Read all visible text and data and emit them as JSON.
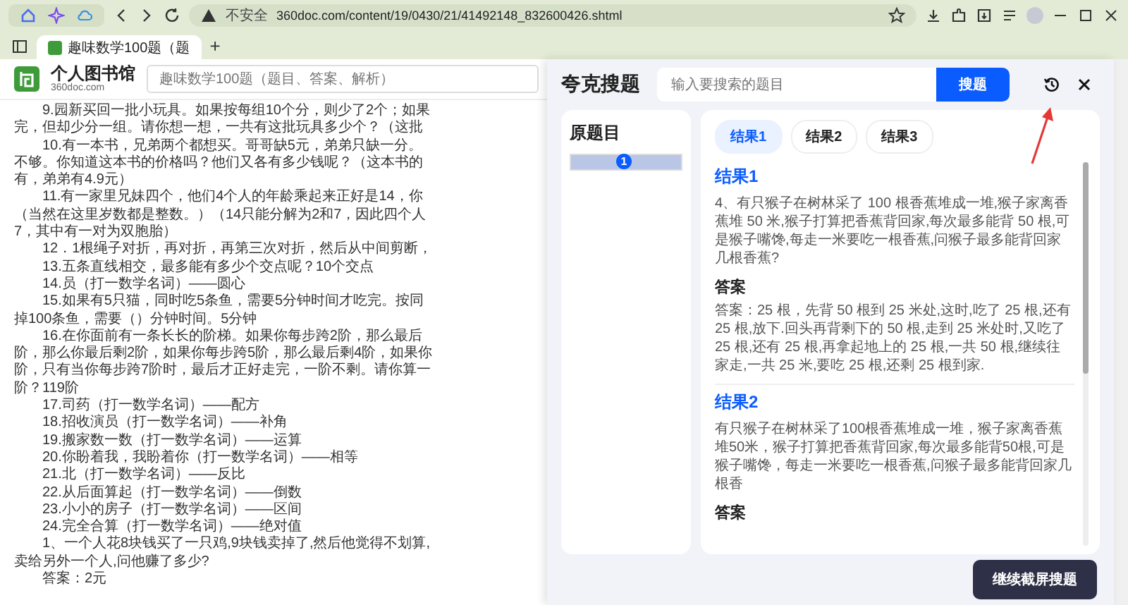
{
  "browser": {
    "security_label": "不安全",
    "url": "360doc.com/content/19/0430/21/41492148_832600426.shtml",
    "tabs": [
      {
        "title": "趣味数学100题（题",
        "selected": true
      }
    ],
    "new_tab": "+"
  },
  "site": {
    "logo_name": "个人图书馆",
    "logo_domain": "360doc.com",
    "search_placeholder": "趣味数学100题（题目、答案、解析）"
  },
  "article": {
    "lines": [
      {
        "text": "9.园新买回一批小玩具。如果按每组10个分，则少了2个；如果",
        "indent": true
      },
      {
        "text": "完，但却少分一组。请你想一想，一共有这批玩具多少个？（这批",
        "indent": false
      },
      {
        "text": "10.有一本书，兄弟两个都想买。哥哥缺5元，弟弟只缺一分。",
        "indent": true
      },
      {
        "text": "不够。你知道这本书的价格吗？他们又各有多少钱呢？（这本书的",
        "indent": false
      },
      {
        "text": "有，弟弟有4.9元）",
        "indent": false
      },
      {
        "text": "11.有一家里兄妹四个，他们4个人的年龄乘起来正好是14，你",
        "indent": true
      },
      {
        "text": "（当然在这里岁数都是整数。）（14只能分解为2和7，因此四个人",
        "indent": false
      },
      {
        "text": "7，其中有一对为双胞胎）",
        "indent": false
      },
      {
        "text": "12．1根绳子对折，再对折，再第三次对折，然后从中间剪断，",
        "indent": true
      },
      {
        "text": "13.五条直线相交，最多能有多少个交点呢？10个交点",
        "indent": true
      },
      {
        "text": "14.员（打一数学名词）——圆心",
        "indent": true
      },
      {
        "text": "15.如果有5只猫，同时吃5条鱼，需要5分钟时间才吃完。按同",
        "indent": true
      },
      {
        "text": "掉100条鱼，需要（）分钟时间。5分钟",
        "indent": false
      },
      {
        "text": "16.在你面前有一条长长的阶梯。如果你每步跨2阶，那么最后",
        "indent": true
      },
      {
        "text": "阶，那么你最后剩2阶，如果你每步跨5阶，那么最后剩4阶，如果你",
        "indent": false
      },
      {
        "text": "阶，只有当你每步跨7阶时，最后才正好走完，一阶不剩。请你算一",
        "indent": false
      },
      {
        "text": "阶？119阶",
        "indent": false
      },
      {
        "text": "17.司药（打一数学名词）——配方",
        "indent": true
      },
      {
        "text": "18.招收演员（打一数学名词）——补角",
        "indent": true
      },
      {
        "text": "19.搬家数一数（打一数学名词）——运算",
        "indent": true
      },
      {
        "text": "20.你盼着我，我盼着你（打一数学名词）——相等",
        "indent": true
      },
      {
        "text": "21.北（打一数学名词）——反比",
        "indent": true
      },
      {
        "text": "22.从后面算起（打一数学名词）——倒数",
        "indent": true
      },
      {
        "text": "23.小小的房子（打一数学名词）——区间",
        "indent": true
      },
      {
        "text": "24.完全合算（打一数学名词）——绝对值",
        "indent": true
      },
      {
        "text": "1、一个人花8块钱买了一只鸡,9块钱卖掉了,然后他觉得不划算,",
        "indent": true
      },
      {
        "text": "卖给另外一个人,问他赚了多少?",
        "indent": false
      },
      {
        "text": "答案：2元",
        "indent": true
      }
    ]
  },
  "panel": {
    "title": "夸克搜题",
    "search_placeholder": "输入要搜索的题目",
    "search_button": "搜题",
    "original": {
      "title": "原题目",
      "badge": "1"
    },
    "result_tabs": [
      {
        "label": "结果1",
        "selected": true
      },
      {
        "label": "结果2",
        "selected": false
      },
      {
        "label": "结果3",
        "selected": false
      }
    ],
    "results": [
      {
        "title": "结果1",
        "question": "4、有只猴子在树林采了 100 根香蕉堆成一堆,猴子家离香蕉堆 50 米,猴子打算把香蕉背回家,每次最多能背 50 根,可是猴子嘴馋,每走一米要吃一根香蕉,问猴子最多能背回家几根香蕉?",
        "answer_heading": "答案",
        "answer": "答案：25 根，先背 50 根到 25 米处,这时,吃了 25 根,还有 25 根,放下.回头再背剩下的 50 根,走到 25 米处时,又吃了 25 根,还有 25 根,再拿起地上的 25 根,一共 50 根,继续往家走,一共 25 米,要吃 25 根,还剩 25 根到家."
      },
      {
        "title": "结果2",
        "question": "有只猴子在树林采了100根香蕉堆成一堆，猴子家离香蕉堆50米，猴子打算把香蕉背回家,每次最多能背50根,可是猴子嘴馋，每走一米要吃一根香蕉,问猴子最多能背回家几根香",
        "answer_heading": "答案"
      }
    ],
    "continue_button": "继续截屏搜题"
  }
}
